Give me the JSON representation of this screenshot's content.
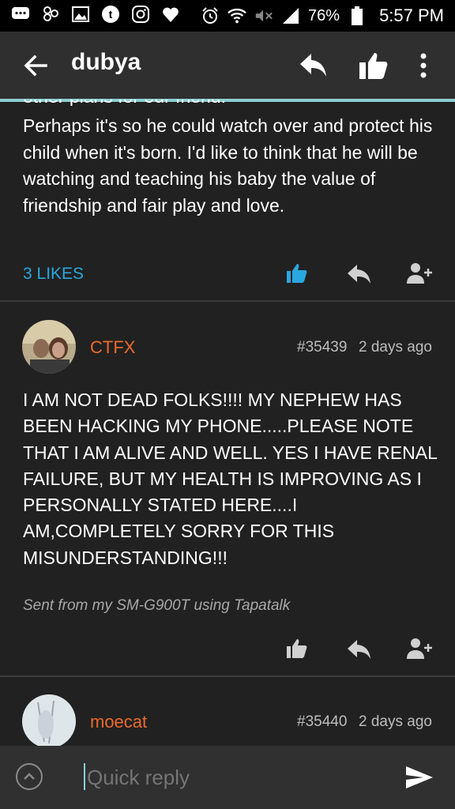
{
  "status_bar": {
    "battery": "76%",
    "time": "5:57 PM",
    "icons": [
      "message-icon",
      "gallery-icon",
      "image-icon",
      "tumblr-icon",
      "instagram-icon",
      "heart-icon",
      "alarm-icon",
      "wifi-icon",
      "mute-icon",
      "signal-icon",
      "battery-icon"
    ]
  },
  "app_bar": {
    "title": "dubya",
    "icons": [
      "back-arrow-icon",
      "reply-icon",
      "thumbs-up-icon",
      "more-vert-icon"
    ]
  },
  "posts": [
    {
      "cut_text": "other plans for our friend.",
      "body": "Perhaps it's so he could watch over and protect his child when it's born. I'd like to think that he will be watching and teaching his baby the value of friendship and fair play and love.",
      "likes": "3 LIKES",
      "liked": true
    },
    {
      "author": "CTFX",
      "number": "#35439",
      "time": "2 days ago",
      "body": "I AM NOT DEAD FOLKS!!!! MY NEPHEW HAS BEEN HACKING MY PHONE.....PLEASE NOTE THAT I AM ALIVE AND WELL. YES I HAVE RENAL FAILURE, BUT MY HEALTH IS IMPROVING AS I PERSONALLY STATED HERE....I AM,COMPLETELY SORRY FOR THIS MISUNDERSTANDING!!!",
      "signature": "Sent from my SM-G900T using Tapatalk"
    },
    {
      "author": "moecat",
      "number": "#35440",
      "time": "2 days ago"
    }
  ],
  "reply_bar": {
    "placeholder": "Quick reply"
  },
  "colors": {
    "background": "#212121",
    "appbar": "#2f2f2f",
    "accent_line": "#8ccfd3",
    "likes_blue": "#29a8e0",
    "author_orange": "#ee6a2c"
  }
}
